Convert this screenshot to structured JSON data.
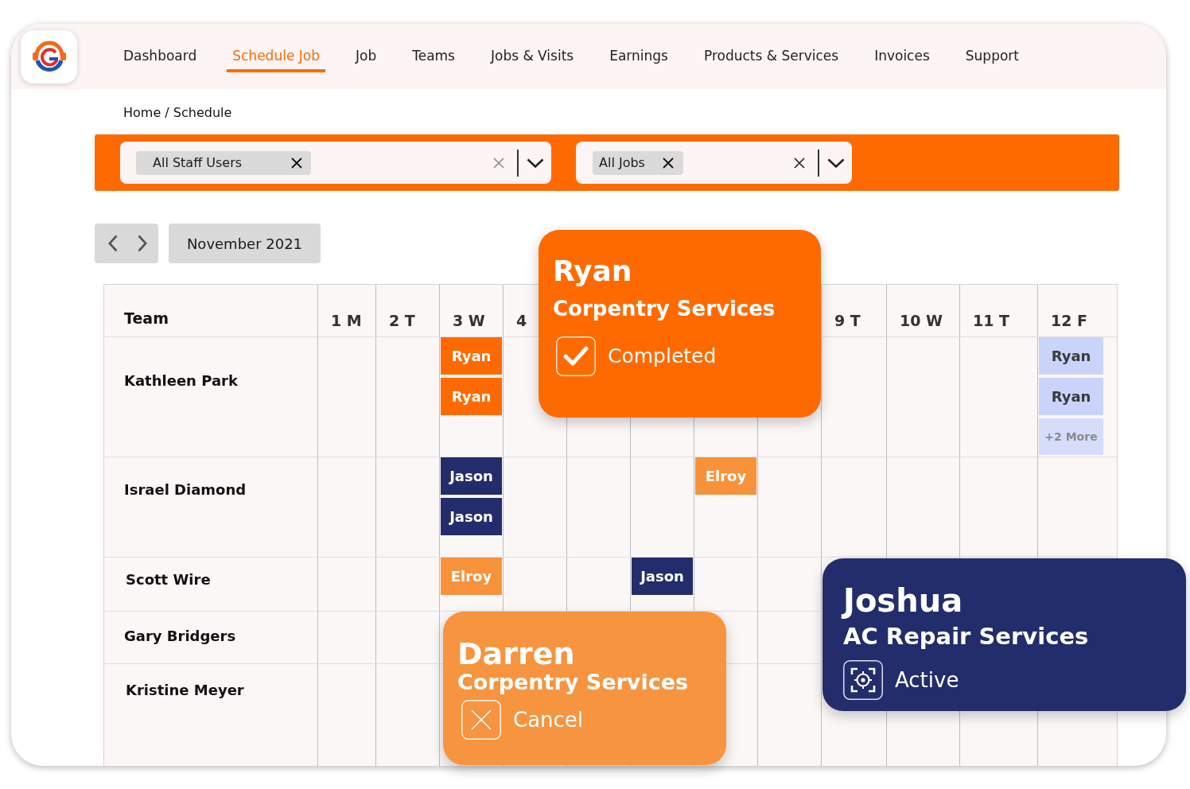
{
  "nav": {
    "items": [
      {
        "label": "Dashboard",
        "selected": false
      },
      {
        "label": "Schedule Job",
        "selected": true
      },
      {
        "label": "Job",
        "selected": false
      },
      {
        "label": "Teams",
        "selected": false
      },
      {
        "label": "Jobs & Visits",
        "selected": false
      },
      {
        "label": "Earnings",
        "selected": false
      },
      {
        "label": "Products & Services",
        "selected": false
      },
      {
        "label": "Invoices",
        "selected": false
      },
      {
        "label": "Support",
        "selected": false
      }
    ]
  },
  "breadcrumb": "Home / Schedule",
  "filters": [
    {
      "chip": "All Staff Users"
    },
    {
      "chip": "All Jobs"
    }
  ],
  "month": "November 2021",
  "calendar": {
    "team_header": "Team",
    "days": [
      {
        "label": "1 M"
      },
      {
        "label": "2 T"
      },
      {
        "label": "3 W"
      },
      {
        "label": "4"
      },
      {
        "label": "9 T"
      },
      {
        "label": "10 W"
      },
      {
        "label": "11 T"
      },
      {
        "label": "12 F"
      }
    ],
    "rows": [
      {
        "name": "Kathleen Park",
        "cells": [
          {},
          {},
          {
            "events": [
              {
                "kind": "job",
                "label": "Ryan",
                "color": "#ff6a00"
              },
              {
                "kind": "job",
                "label": "Ryan",
                "color": "#ff6a00"
              }
            ]
          },
          {},
          {},
          {},
          {},
          {},
          {},
          {},
          {},
          {
            "events": [
              {
                "kind": "job",
                "label": "Ryan",
                "color": "#cad4fb"
              },
              {
                "kind": "job",
                "label": "Ryan",
                "color": "#cad4fb"
              },
              {
                "kind": "more",
                "label": "+2 More",
                "color": "#d5ddfb"
              }
            ]
          }
        ]
      },
      {
        "name": "Israel Diamond",
        "cells": [
          {},
          {},
          {
            "events": [
              {
                "kind": "job",
                "label": "Jason",
                "color": "#232d6b"
              },
              {
                "kind": "job",
                "label": "Jason",
                "color": "#232d6b"
              }
            ]
          },
          {},
          {},
          {},
          {
            "events": [
              {
                "kind": "job",
                "label": "Elroy",
                "color": "#f7923a"
              }
            ]
          },
          {},
          {},
          {},
          {},
          {}
        ]
      },
      {
        "name": "Scott Wire",
        "cells": [
          {},
          {},
          {
            "events": [
              {
                "kind": "job",
                "label": "Elroy",
                "color": "#f7923a"
              }
            ]
          },
          {},
          {},
          {
            "events": [
              {
                "kind": "job",
                "label": "Jason",
                "color": "#232d6b"
              }
            ]
          },
          {},
          {},
          {},
          {},
          {},
          {}
        ]
      },
      {
        "name": "Gary Bridgers"
      },
      {
        "name": "Kristine Meyer"
      }
    ]
  },
  "popups": [
    {
      "kind": "completed",
      "color": "#ff6a00",
      "name": "Ryan",
      "service": "Corpentry Services",
      "status": "Completed"
    },
    {
      "kind": "cancelled",
      "color": "#f7943f",
      "name": "Darren",
      "service": "Corpentry Services",
      "status": "Cancel"
    },
    {
      "kind": "active",
      "color": "#232d6b",
      "name": "Joshua",
      "service": "AC Repair Services",
      "status": "Active"
    }
  ]
}
